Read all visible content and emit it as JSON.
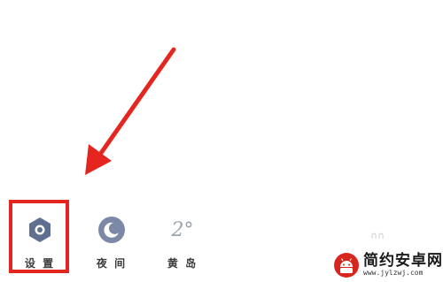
{
  "toolbar": {
    "items": [
      {
        "label": "设 置",
        "icon": "settings-hexagon-icon"
      },
      {
        "label": "夜 间",
        "icon": "moon-icon"
      },
      {
        "label": "黄 岛",
        "weather": "2°"
      }
    ]
  },
  "stray_mark": "∩∩",
  "annotation": {
    "color": "#e5251f"
  },
  "watermark": {
    "title": "简约安卓网",
    "url": "www.jylzwj.com"
  }
}
